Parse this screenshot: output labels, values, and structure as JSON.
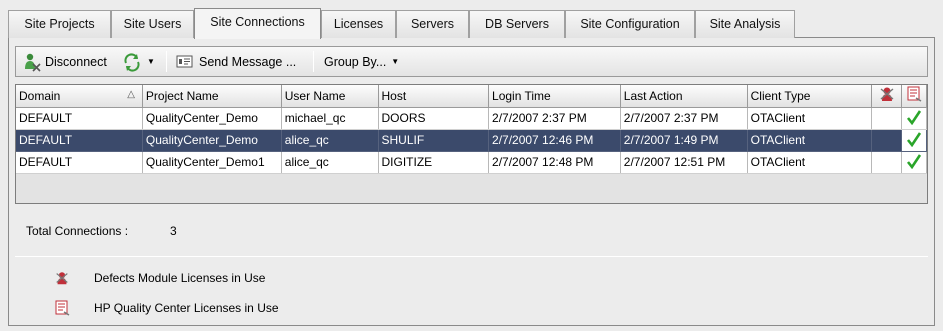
{
  "tabs": [
    {
      "label": "Site Projects"
    },
    {
      "label": "Site Users"
    },
    {
      "label": "Site Connections"
    },
    {
      "label": "Licenses"
    },
    {
      "label": "Servers"
    },
    {
      "label": "DB Servers"
    },
    {
      "label": "Site Configuration"
    },
    {
      "label": "Site Analysis"
    }
  ],
  "toolbar": {
    "disconnect_label": "Disconnect",
    "refresh_icon": "refresh-icon",
    "send_message_label": "Send Message ...",
    "group_by_label": "Group By..."
  },
  "grid": {
    "columns": [
      "Domain",
      "Project Name",
      "User Name",
      "Host",
      "Login Time",
      "Last Action",
      "Client Type"
    ],
    "sort_indicator": "△",
    "rows": [
      {
        "domain": "DEFAULT",
        "project": "QualityCenter_Demo",
        "user": "michael_qc",
        "host": "DOORS",
        "login": "2/7/2007 2:37 PM",
        "last": "2/7/2007 2:37 PM",
        "client": "OTAClient"
      },
      {
        "domain": "DEFAULT",
        "project": "QualityCenter_Demo",
        "user": "alice_qc",
        "host": "SHULIF",
        "login": "2/7/2007 12:46 PM",
        "last": "2/7/2007 1:49 PM",
        "client": "OTAClient"
      },
      {
        "domain": "DEFAULT",
        "project": "QualityCenter_Demo1",
        "user": "alice_qc",
        "host": "DIGITIZE",
        "login": "2/7/2007 12:48 PM",
        "last": "2/7/2007 12:51 PM",
        "client": "OTAClient"
      }
    ]
  },
  "summary": {
    "total_label": "Total Connections :",
    "total_value": "3"
  },
  "legend": {
    "defects_label": "Defects Module Licenses in Use",
    "qc_label": "HP Quality Center Licenses in Use"
  },
  "colors": {
    "selected_row": "#3b4a6b",
    "check_green": "#2aa52a",
    "defects_icon_red": "#c0303a"
  }
}
